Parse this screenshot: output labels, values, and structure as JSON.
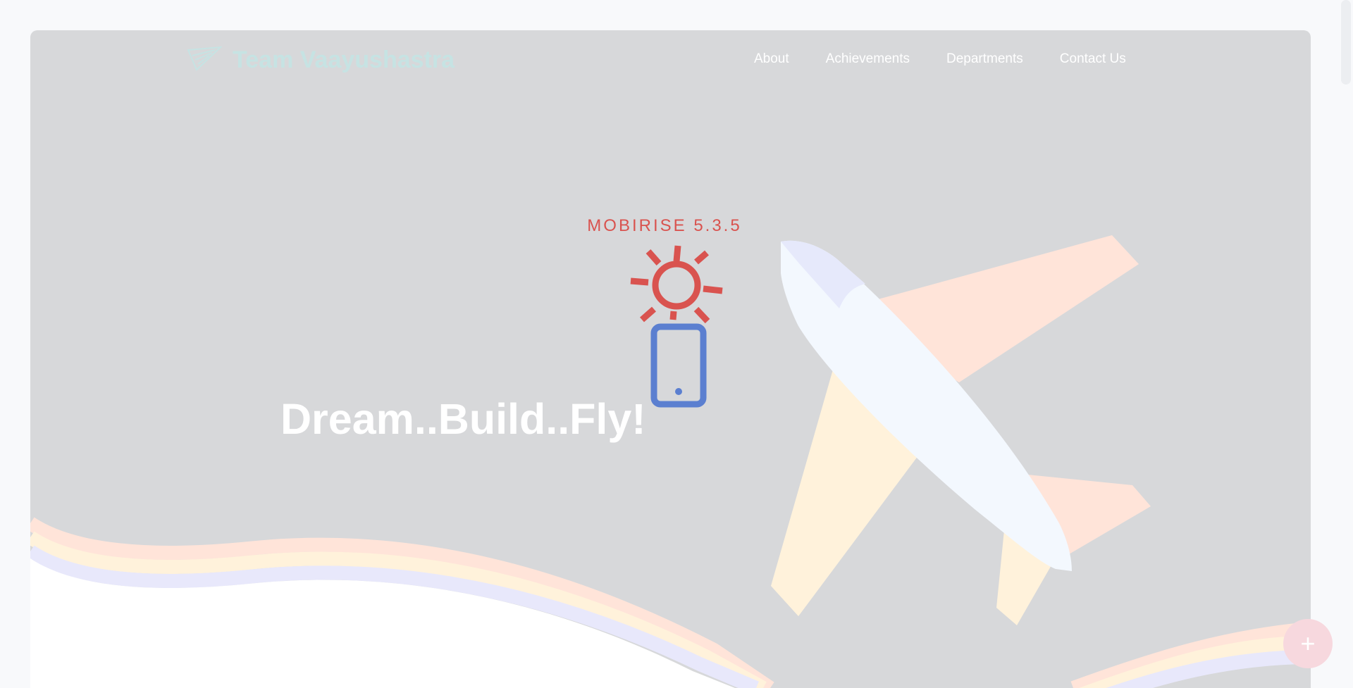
{
  "brand": {
    "name": "Team Vaayushastra",
    "logo_icon": "paper-plane-logo-icon"
  },
  "nav": {
    "items": [
      {
        "label": "About"
      },
      {
        "label": "Achievements"
      },
      {
        "label": "Departments"
      },
      {
        "label": "Contact Us"
      }
    ]
  },
  "hero": {
    "headline": "Dream..Build..Fly!",
    "illustration_icon": "airplane-illustration"
  },
  "badge": {
    "text": "MOBIRISE  5.3.5",
    "icon": "sun-phone-icon"
  },
  "fab": {
    "label": "+",
    "icon": "plus-icon"
  },
  "colors": {
    "hero_bg": "#d7d8da",
    "brand_text": "#c6e3e3",
    "mobirise_red": "#d9534f",
    "mobirise_blue": "#5b7fd0",
    "stripe_peach": "#ffe4d9",
    "stripe_cream": "#fff2db",
    "stripe_lavender": "#e8e8fb"
  }
}
